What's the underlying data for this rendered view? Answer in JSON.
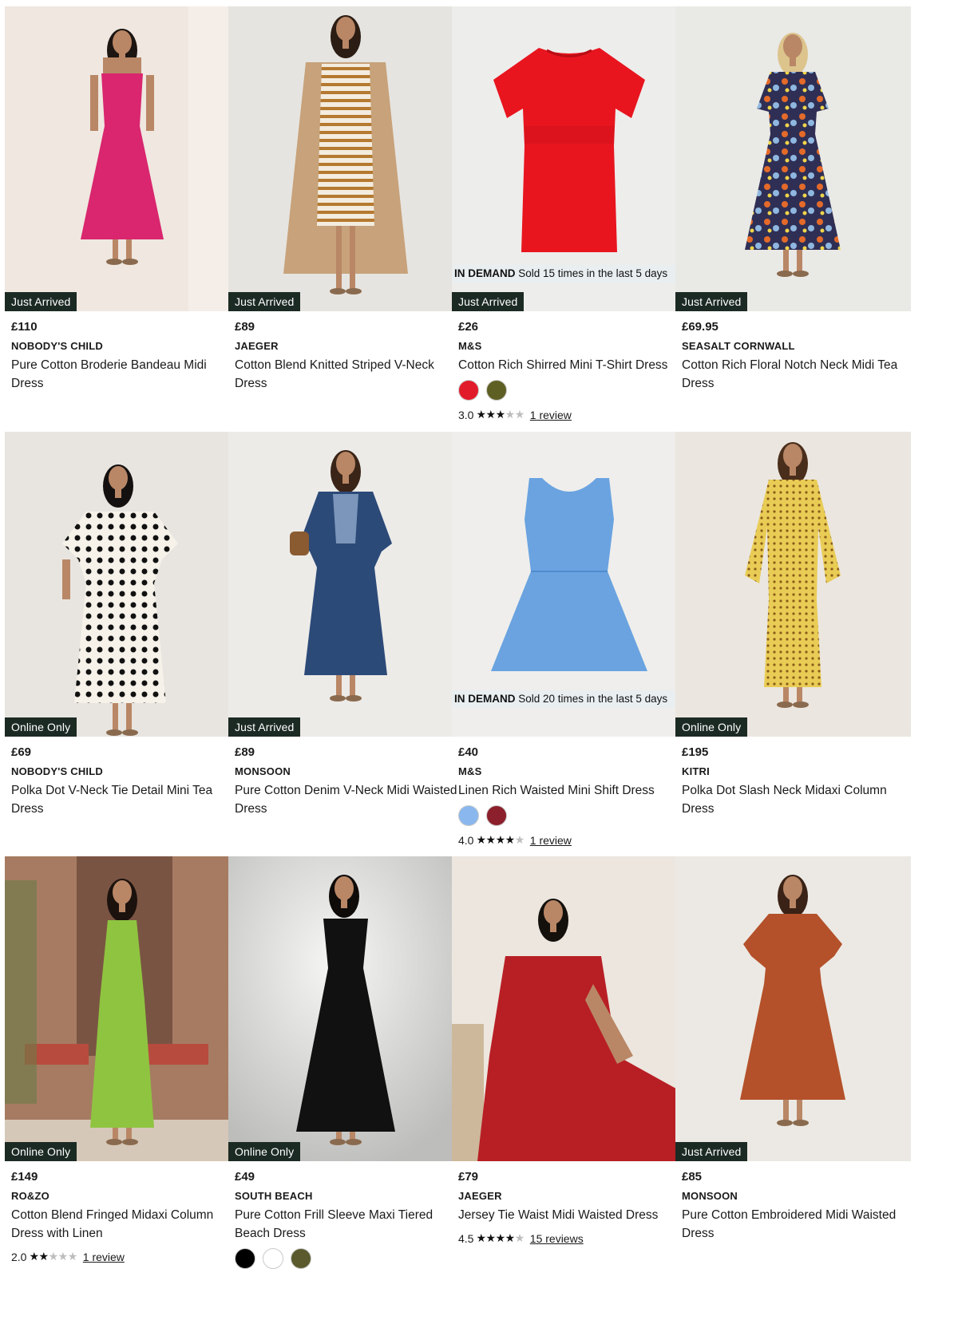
{
  "products": [
    {
      "price": "£110",
      "brand": "NOBODY'S CHILD",
      "title": "Pure Cotton Broderie Bandeau Midi Dress",
      "badge": "Just Arrived",
      "image": {
        "bg": "#efe7e0",
        "garment": "#d9266e",
        "style": "strapless-midi"
      }
    },
    {
      "price": "£89",
      "brand": "JAEGER",
      "title": "Cotton Blend Knitted Striped V-Neck Dress",
      "badge": "Just Arrived",
      "image": {
        "bg": "#e6e4e0",
        "garment": "#c7a27a",
        "style": "coat-stripe"
      }
    },
    {
      "price": "£26",
      "brand": "M&S",
      "title": "Cotton Rich Shirred Mini T-Shirt Dress",
      "badge": "Just Arrived",
      "in_demand": {
        "label": "IN DEMAND",
        "text": "Sold 15 times in the last 5 days"
      },
      "swatches": [
        "#e11b2a",
        "#5e5f22"
      ],
      "rating": {
        "score": "3.0",
        "value": 3,
        "reviews": "1 review"
      },
      "image": {
        "bg": "#ededeb",
        "garment": "#e8151f",
        "style": "flat-tshirt"
      }
    },
    {
      "price": "£69.95",
      "brand": "SEASALT CORNWALL",
      "title": "Cotton Rich Floral Notch Neck Midi Tea Dress",
      "badge": "Just Arrived",
      "image": {
        "bg": "#e9e9e6",
        "garment": "#3b3a6c",
        "style": "floral-midi"
      }
    },
    {
      "price": "£69",
      "brand": "NOBODY'S CHILD",
      "title": "Polka Dot V-Neck Tie Detail Mini Tea Dress",
      "badge": "Online Only",
      "image": {
        "bg": "#e8e5e0",
        "garment": "#f4f1ea",
        "style": "polka-mini"
      }
    },
    {
      "price": "£89",
      "brand": "MONSOON",
      "title": "Pure Cotton Denim V-Neck Midi Waisted Dress",
      "badge": "Just Arrived",
      "image": {
        "bg": "#ecebe8",
        "garment": "#2c4a78",
        "style": "denim-midi"
      }
    },
    {
      "price": "£40",
      "brand": "M&S",
      "title": "Linen Rich Waisted Mini Shift Dress",
      "in_demand": {
        "label": "IN DEMAND",
        "text": "Sold 20 times in the last 5 days"
      },
      "swatches": [
        "#8ab8ee",
        "#8c1f2c"
      ],
      "rating": {
        "score": "4.0",
        "value": 4,
        "reviews": "1 review"
      },
      "image": {
        "bg": "#efeeec",
        "garment": "#6aa3e0",
        "style": "flat-tank"
      }
    },
    {
      "price": "£195",
      "brand": "KITRI",
      "title": "Polka Dot Slash Neck Midaxi Column Dress",
      "badge": "Online Only",
      "image": {
        "bg": "#ebe6df",
        "garment": "#e9cc55",
        "style": "yellow-column"
      }
    },
    {
      "price": "£149",
      "brand": "RO&ZO",
      "title": "Cotton Blend Fringed Midaxi Column Dress with Linen",
      "badge": "Online Only",
      "rating": {
        "score": "2.0",
        "value": 2,
        "reviews": "1 review"
      },
      "image": {
        "bg": "#a37860",
        "garment": "#8fc440",
        "style": "green-halter"
      }
    },
    {
      "price": "£49",
      "brand": "SOUTH BEACH",
      "title": "Pure Cotton Frill Sleeve Maxi Tiered Beach Dress",
      "badge": "Online Only",
      "swatches": [
        "#000000",
        "#ffffff",
        "#5a5a2e"
      ],
      "image": {
        "bg": "#d9d9d7",
        "garment": "#111111",
        "style": "black-maxi"
      }
    },
    {
      "price": "£79",
      "brand": "JAEGER",
      "title": "Jersey Tie Waist Midi Waisted Dress",
      "rating": {
        "score": "4.5",
        "value": 4.5,
        "reviews": "15 reviews"
      },
      "image": {
        "bg": "#ece7e0",
        "garment": "#b81f25",
        "style": "red-seated"
      }
    },
    {
      "price": "£85",
      "brand": "MONSOON",
      "title": "Pure Cotton Embroidered Midi Waisted Dress",
      "badge": "Just Arrived",
      "image": {
        "bg": "#ece9e4",
        "garment": "#b4512a",
        "style": "rust-midi"
      }
    }
  ]
}
